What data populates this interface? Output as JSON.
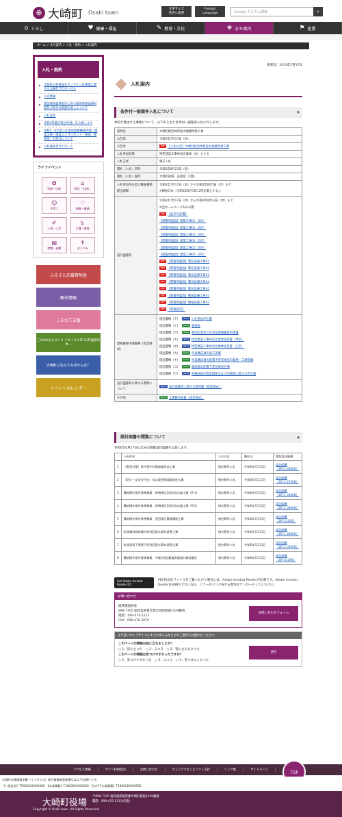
{
  "header": {
    "logo_mark": "⊕",
    "logo_text": "大崎町",
    "logo_en": "Osaki town",
    "font_size_btn": "文字サイズ\n色合い変更",
    "foreign_btn": "Foreign\nLanguage",
    "search_placeholder": "Google カスタム検索",
    "search_btn": "⌕"
  },
  "gnav": [
    {
      "label": "くらし",
      "icon": "⌂"
    },
    {
      "label": "健康・福祉",
      "icon": "♥"
    },
    {
      "label": "教育・文化",
      "icon": "✎"
    },
    {
      "label": "まち案内",
      "icon": "❀"
    },
    {
      "label": "産業",
      "icon": "⚑"
    }
  ],
  "breadcrumb": "ホーム > まち案内 > 入札・契約 > 入札案内",
  "sidebar": {
    "title": "入札・契約",
    "items": [
      "大崎町公共施設のオンライン化事業に関する公募型プロポーザル",
      "公売情報",
      "建設関連業務委託に係る最低制限価格制度及び総合払制度の導入について",
      "入札案内",
      "令和6年度の発注見通しを公表します",
      "令和5・6年度入札参加資格審査申請（建設工事・建設コンサルタント・物品・委託等）の受付について",
      "入札様式ダウンロード"
    ],
    "life_title": "ライフイベント",
    "life": [
      {
        "label": "妊娠・出産",
        "icon": "✿"
      },
      {
        "label": "移住・引越し",
        "icon": "⌂"
      },
      {
        "label": "子育て",
        "icon": "☺"
      },
      {
        "label": "結婚・離婚",
        "icon": "♡"
      },
      {
        "label": "入園・入学",
        "icon": "✐"
      },
      {
        "label": "介護・障害",
        "icon": "♿"
      },
      {
        "label": "就職・退職",
        "icon": "▤"
      },
      {
        "label": "おくやみ",
        "icon": "✝"
      }
    ],
    "banners": [
      {
        "label": "ふるさと応援寄附金",
        "color": "#c44a4a"
      },
      {
        "label": "観光情報",
        "color": "#7a5fa8"
      },
      {
        "label": "こそだて支援",
        "color": "#e07a9a"
      },
      {
        "label": "ごみ0のまちづくり リサイクル率 12年連続日本一",
        "color": "#5a8a2a"
      },
      {
        "label": "大崎町に住んでみませんか？",
        "color": "#3a5ea8"
      },
      {
        "label": "イベントカレンダー",
        "color": "#c9a020"
      }
    ]
  },
  "main": {
    "updated": "更新日：2024年7月17日",
    "title": "入札案内",
    "section1": "条件付一般競争入札について",
    "intro": "本町が発注する事業について、以下のとおり条件付一般競争入札に付します。",
    "rows": [
      [
        "案件名",
        "大崎町総合体育館大規模改修工事"
      ],
      [
        "公告日",
        "令和6年7月17日（水）"
      ],
      [
        "公告文",
        "【入札公告】大崎町総合体育館大規模改修工事"
      ],
      [
        "入札参加形態",
        "特定建設工事共同企業体（JV）とする"
      ],
      [
        "入札方式",
        "電子入札"
      ],
      [
        "開札（入札）日時",
        "令和6年8月23日（金）"
      ],
      [
        "開札（入札）場所",
        "大崎町役場　応接室（2階）"
      ],
      [
        "入札参加申込及び審査書類提出期間",
        "令和6年7月17日（水）から令和6年8月5日（月）まで\n※郵送のみ（令和6年8月5日12時必着とする。）"
      ]
    ],
    "design_label": "設計図書等",
    "design_period": "令和6年7月17日（水）から令和6年8月22日（木）まで",
    "design_note": "※当ホームページのみ公開",
    "design_items": [
      [
        "pdf",
        "【設計内訳書】"
      ],
      [
        "",
        "【閲覧用図面】建築工事01（ZIP）"
      ],
      [
        "",
        "【閲覧用図面】建築工事02（ZIP）"
      ],
      [
        "",
        "【閲覧用図面】建築工事03（ZIP）"
      ],
      [
        "",
        "【閲覧用図面】建築工事04（ZIP）"
      ],
      [
        "",
        "【閲覧用図面】建築工事05（ZIP）"
      ],
      [
        "",
        "【閲覧用図面】建築工事06（ZIP）"
      ],
      [
        "pdf",
        "【閲覧用図面】電気設備工事01"
      ],
      [
        "pdf",
        "【閲覧用図面】電気設備工事02"
      ],
      [
        "pdf",
        "【閲覧用図面】電気設備工事03"
      ],
      [
        "pdf",
        "【閲覧用図面】電気設備工事04"
      ],
      [
        "pdf",
        "【閲覧用図面】電気設備工事05"
      ],
      [
        "pdf",
        "【閲覧用図面】機械設備工事01"
      ],
      [
        "pdf",
        "【閲覧用図面】機械設備工事02"
      ],
      [
        "pdf",
        "【質疑回答】"
      ]
    ],
    "qual_label": "資格審査申請書類（指定様式）",
    "qual_items": [
      [
        "提出書類（ア）",
        "word",
        "入札参加申込書"
      ],
      [
        "提出書類（イ）",
        "excel",
        "資格表"
      ],
      [
        "提出書類（ウ）",
        "excel",
        "共同企業体入札参加資格審査申請書"
      ],
      [
        "提出書類（エ）",
        "word",
        "特定建設工事共同企業体協定書（甲型）"
      ],
      [
        "提出書類（オ）",
        "word",
        "特定建設工事共同企業体協定書（乙型）"
      ],
      [
        "提出書類（カ）",
        "excel",
        "代表構成員の施工実績"
      ],
      [
        "提出書類（キ）",
        "excel",
        "代表構成員の配置予定技術者の資格・工事経験"
      ],
      [
        "提出書類（コ）",
        "excel",
        "構成員の配置予定技術者名簿"
      ],
      [
        "提出書類（サ）",
        "word",
        "各構成員の資本関係又は人的関係に関する申告書"
      ]
    ],
    "question_label": "設計図書等に関する質問について",
    "question_item": "設計図書等に関する質問書（指定様式）",
    "other_label": "その他",
    "other_item": "工事費内訳書（指定様式）",
    "section2": "設計図書の閲覧について",
    "intro2": "令和6年6月27日公告分の閲覧設計図書を公開します。",
    "t2_head": [
      "入札件名",
      "入札方式",
      "開札日",
      "閲覧設計図書"
    ],
    "t2_rows": [
      [
        "1",
        "（緊急対策）県中堤中村線道路改良工事",
        "指名競争入札",
        "令和6年7月11日",
        "設計図書（ZIP:2.288KB）"
      ],
      [
        "2",
        "（防災・安全交付金）永吉東田線道路改良工事",
        "指名競争入札",
        "令和6年7月11日",
        "設計図書（ZIP:2.274KB）"
      ],
      [
        "3",
        "農地耕作条件改善事業　神領地区2地区排水路工事（R-1）",
        "指名競争入札",
        "令和6年7月11日",
        "設計図書（ZIP:1.340KB）"
      ],
      [
        "4",
        "農地耕作条件改善事業　神領地区2地区排水路工事（R-2）",
        "指名競争入札",
        "令和6年7月11日",
        "設計図書（ZIP:1.086KB）"
      ],
      [
        "5",
        "農地耕作条件改善事業　長田地区農道舗装工事",
        "指名競争入札",
        "令和6年7月11日",
        "設計図書（ZIP:122KB）"
      ],
      [
        "6",
        "町道場内緑地域内他地区配水管布設替工事",
        "指名競争入札",
        "令和6年7月11日",
        "設計図書（ZIP:1.688KB）"
      ],
      [
        "7",
        "町道長塚下原線下原地区配水管布設替工事",
        "指名競争入札",
        "令和6年7月11日",
        "設計図書（ZIP:1.359KB）"
      ],
      [
        "8",
        "農地耕作条件改善事業　中尾2地区農道測量設計業務委託",
        "指名競争入札",
        "令和6年7月11日",
        "設計図書（ZIP:612KB）"
      ]
    ],
    "adobe_btn": "Get Adobe Acrobat Reader DC",
    "adobe_text": "PDF形式のファイルをご覧いただく場合には、Adobe Acrobat Readerが必要です。Adobe Acrobat Readerをお持ちでない方は、バナーのリンク先から無料ダウンロードしてください。",
    "inq_title": "お問い合わせ",
    "inq_lines": [
      "総務課契約係",
      "899-7305 鹿児島県曽於郡大崎町假宿1029番地",
      "電話：099-476-1111",
      "FAX：099-476-3979"
    ],
    "inq_btn": "お問い合わせフォーム",
    "fb_title": "より良いウェブサイトにするためにみなさまのご意見をお聞かせください",
    "fb_q1": "このページの情報は役に立ちましたか？",
    "fb_a1": "○ 1：役に立った　○ 2：ふつう　○ 3：役に立たなかった",
    "fb_q2": "このページの情報は見つけやすかったですか？",
    "fb_a2": "○ 1：見つけやすかった　○ 2：ふつう　○ 3：見つけにくかった",
    "fb_btn": "送信"
  },
  "footer": {
    "nav": [
      "アクセス情報",
      "サイト利用案内",
      "お問い合わせ",
      "ウェブアクセシビリティ方針",
      "リンク集",
      "サイトマップ"
    ],
    "top": "TOP",
    "info1": "大崎町の適格請求書（インボイス）発行事業者登録番号は以下の通りです。",
    "info2": "【一般会計】T9000020464686　【水道事業】T1800020000590　【公共下水道事業】T1800020006556",
    "logo": "大崎町役場",
    "address": "〒899-7305 鹿児島県曽於郡大崎町假宿1029番地\n電話：099-476-1111(代表)",
    "copyright": "Copyright © Osaki town. All Rights Reserved."
  }
}
